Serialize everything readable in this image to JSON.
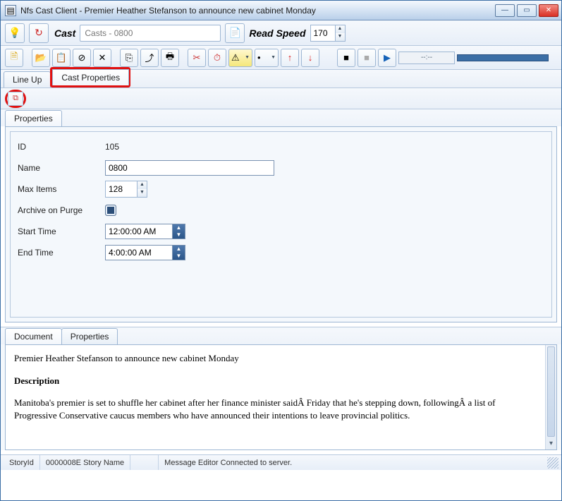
{
  "window": {
    "title": "Nfs Cast Client - Premier Heather Stefanson to announce new cabinet Monday"
  },
  "iconglyph": {
    "app": "▤",
    "bulb": "💡",
    "refresh": "↻",
    "page": "📄",
    "new": "🗎",
    "open": "📂",
    "paste": "📋",
    "nosym": "⊘",
    "close_x": "✕",
    "copy": "⎘",
    "export": "⤴",
    "print": "🖶",
    "cut": "✂",
    "clock": "⏱",
    "warn": "⚠",
    "dot": "•",
    "up": "↑",
    "down": "↓",
    "stop": "■",
    "play": "▶",
    "duplicate": "⧉"
  },
  "top": {
    "cast_label": "Cast",
    "cast_value": "Casts - 0800",
    "readspeed_label": "Read Speed",
    "readspeed_value": "170"
  },
  "media": {
    "time": "--:--"
  },
  "tabs": {
    "lineup": "Line Up",
    "castprops": "Cast Properties"
  },
  "propsTab": "Properties",
  "form": {
    "id_label": "ID",
    "id_value": "105",
    "name_label": "Name",
    "name_value": "0800",
    "max_label": "Max Items",
    "max_value": "128",
    "archive_label": "Archive on Purge",
    "start_label": "Start Time",
    "start_value": "12:00:00 AM",
    "end_label": "End Time",
    "end_value": "4:00:00 AM"
  },
  "docTabs": {
    "document": "Document",
    "properties": "Properties"
  },
  "doc": {
    "title": "Premier Heather Stefanson to announce new cabinet Monday",
    "header": "Description",
    "body": "Manitoba's premier is set to shuffle her cabinet after her finance minister saidÂ Friday that he's stepping down, followingÂ a list of Progressive Conservative caucus members who have announced their intentions to leave provincial politics."
  },
  "status": {
    "storyid_label": "StoryId",
    "storyid_value": "0000008E",
    "storyname_label": "Story Name",
    "message": "Message Editor Connected to server."
  }
}
